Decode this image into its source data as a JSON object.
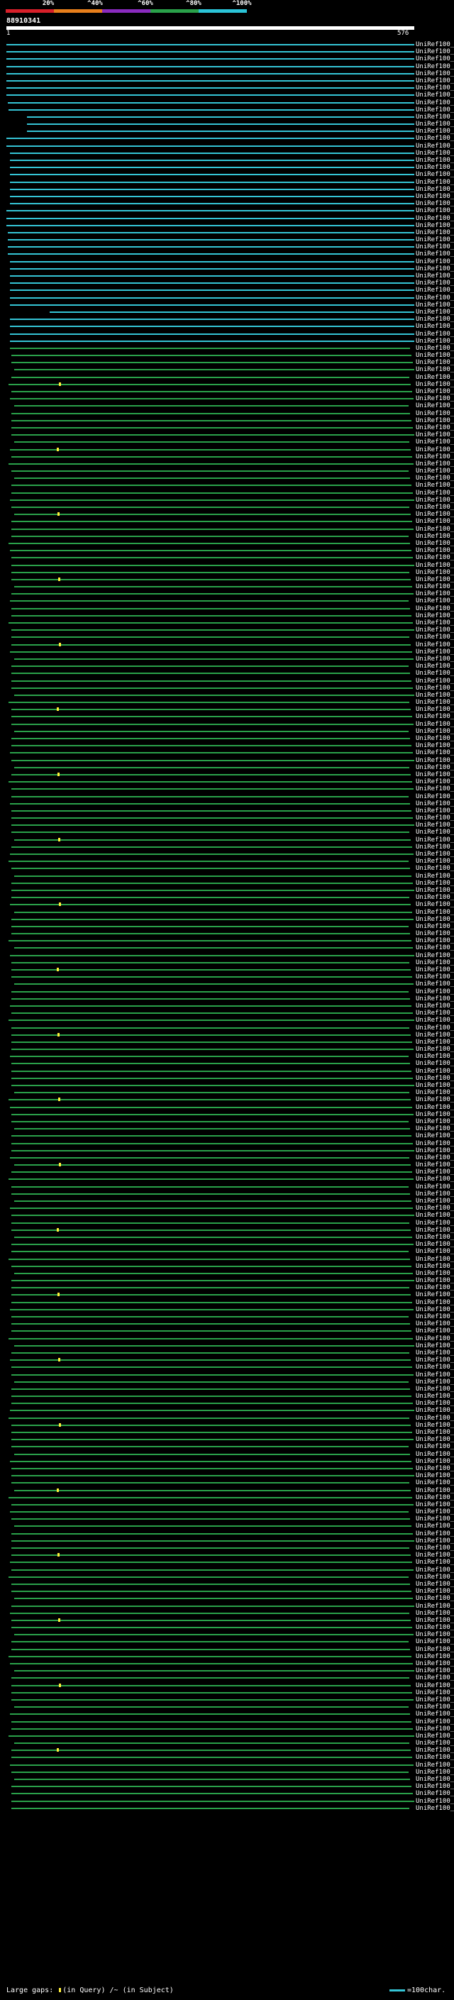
{
  "scale": {
    "labels": [
      "20%",
      "^40%",
      "^60%",
      "^80%",
      "^100%"
    ],
    "colors": [
      "#d8202a",
      "#e87f1c",
      "#8a2bbf",
      "#2aa14a",
      "#2bc3d7"
    ]
  },
  "query": {
    "id": "88910341",
    "start": "1",
    "end": "576"
  },
  "colors": {
    "high": "#35c5d6",
    "medium": "#2aa14a",
    "gap": "#ffef3a"
  },
  "hits": [
    "UniRef100_B9T183",
    "UniRef100_UP1000...",
    "UniRef100_A7Q355",
    "UniRef100_C5XZZ3",
    "UniRef100_Q6ER90",
    "UniRef100_B9AJF3",
    "UniRef100_A5BHW8",
    "UniRef100_UP1000...",
    "UniRef100_A5BJP5",
    "UniRef100_A9RXJ2",
    "UniRef100_A7Q360",
    "UniRef100_A5BRX1",
    "UniRef100_A5BHW9",
    "UniRef100_Q01539",
    "UniRef100_C1E045",
    "UniRef100_A4RZL4",
    "UniRef100_B4S221",
    "UniRef100_A3IS00",
    "UniRef100_Q4CAJ8",
    "UniRef100_Q3MZ48",
    "UniRef100_Q8YN47",
    "UniRef100_B5VWE3",
    "UniRef100_B5V5F7",
    "UniRef100_B1XK20",
    "UniRef100_C1MRF6",
    "UniRef100_A6YFP4",
    "UniRef100_B0JLF7",
    "UniRef100_B8BY34",
    "UniRef100_B0C012",
    "UniRef100_A5GJT7",
    "UniRef100_A4CX57",
    "UniRef100_Q3AW30",
    "UniRef100_Q2DC43",
    "UniRef100_D0C155",
    "UniRef100_B1X5P5",
    "UniRef100_Q7U662",
    "UniRef100_Q01902",
    "UniRef100_Q5QSW1",
    "UniRef100_A3IZ47",
    "UniRef100_B5G6Y8",
    "UniRef100_A9GS19",
    "UniRef100_Q05R70",
    "UniRef100_Q3AYC6",
    "UniRef100_B5IL96",
    "UniRef100_B7J7T0",
    "UniRef100_A0L4J6",
    "UniRef100_Q3UC80",
    "UniRef100_B0VRJ1",
    "UniRef100_B0VRJ2",
    "UniRef100_B2S162",
    "UniRef100_B5YLD2",
    "UniRef100_Q3ZB95",
    "UniRef100_A5FRB3",
    "UniRef100_A1RXE4",
    "UniRef100_C4CRK8",
    "UniRef100_B7QR90",
    "UniRef100_A6ICN7",
    "UniRef100_UP1000...",
    "UniRef100_UP1000...",
    "UniRef100_C0SWP8",
    "UniRef100_C0WKB2",
    "UniRef100_B9C3E7",
    "UniRef100_B9WBN6",
    "UniRef100_Q2SRD5",
    "UniRef100_B7J3S0",
    "UniRef100_C9WW13",
    "UniRef100_Q10401",
    "UniRef100_Q0SMD6",
    "UniRef100_Q1NJM1",
    "UniRef100_B2V6M2",
    "UniRef100_B1KS82",
    "UniRef100_C5VVB1",
    "UniRef100_A6ZLD5",
    "UniRef100_B5Y850",
    "UniRef100_B9Y829",
    "UniRef100_B7G348",
    "UniRef100_B7GV55",
    "UniRef100_B5M588",
    "UniRef100_Q66GF4",
    "UniRef100_C0ZGT7",
    "UniRef100_C0QRZ8",
    "UniRef100_B7K867",
    "UniRef100_C6N5K6",
    "UniRef100_A3IN06",
    "UniRef100_B5MRR3",
    "UniRef100_Q5NLX6",
    "UniRef100_C1DWX0",
    "UniRef100_B1Z8F0",
    "UniRef100_B1WPY0",
    "UniRef100_C4F1I6",
    "UniRef100_B0ULE1",
    "UniRef100_A6VMV8",
    "UniRef100_B5RQ59",
    "UniRef100_Q2JS31",
    "UniRef100_Q7NCU0",
    "UniRef100_B9ZPC7",
    "UniRef100_B4WR20",
    "UniRef100_Q8DGW0",
    "UniRef100_Q2JLF3",
    "UniRef100_B8HSY2",
    "UniRef100_B1XQ05",
    "UniRef100_B2KB24",
    "UniRef100_Q0I4G4",
    "UniRef100_Q8YWW0",
    "UniRef100_Q8YZX0",
    "UniRef100_Q55806",
    "UniRef100_B2J4B0",
    "UniRef100_A0YKJ6",
    "UniRef100_B4VMD8",
    "UniRef100_Q11557",
    "UniRef100_Q8YX65",
    "UniRef100_C6XYI1",
    "UniRef100_C6AWB7",
    "UniRef100_Q1IHB5",
    "UniRef100_B4U7U2",
    "UniRef100_A0US89",
    "UniRef100_Q89TL0",
    "UniRef100_C1F3K5",
    "UniRef100_Q1LR23",
    "UniRef100_A6WAE5",
    "UniRef100_A5G4T7",
    "UniRef100_B1T4K7",
    "UniRef100_B9M524",
    "UniRef100_C4ILJ1",
    "UniRef100_C6PW03",
    "UniRef100_Q2W650",
    "UniRef100_B1N5Y8",
    "UniRef100_A1HTC8",
    "UniRef100_Q3H4P3",
    "UniRef100_B5EBX9",
    "UniRef100_UP1000...",
    "UniRef100_Q39V59",
    "UniRef100_A6R1B6",
    "UniRef100_C8W7Y0",
    "UniRef100_B1ULW1",
    "UniRef100_C7BPV0",
    "UniRef100_A0LFC2",
    "UniRef100_C7GZW4",
    "UniRef100_B0E228",
    "UniRef100_B0K3V8",
    "UniRef100_C0XUG2",
    "UniRef100_UP1000...",
    "UniRef100_Q67583",
    "UniRef100_C7IQZ8",
    "UniRef100_C6SPB0",
    "UniRef100_C6Q900",
    "UniRef100_C6PFY0",
    "UniRef100_B9K8B0",
    "UniRef100_C0GSX6",
    "UniRef100_A7G1V8",
    "UniRef100_A7FYY7",
    "UniRef100_B5YDY7",
    "UniRef100_C6DYJ5",
    "UniRef100_Q3AB56",
    "UniRef100_UP1000...",
    "UniRef100_C4V3B8",
    "UniRef100_B5HSP5",
    "UniRef100_C9L873",
    "UniRef100_B3E1T5",
    "UniRef100_B8J4E4",
    "UniRef100_B1LQT7",
    "UniRef100_B1I4H3",
    "UniRef100_Q2YZU9",
    "UniRef100_C4FPN0",
    "UniRef100_B1YK92",
    "UniRef100_Q8ET12",
    "UniRef100_Q3AMR6",
    "UniRef100_C1ZM36",
    "UniRef100_Q74D04",
    "UniRef100_B6WMN7",
    "UniRef100_B1IMV3",
    "UniRef100_C6HX24",
    "UniRef100_B5GNX0",
    "UniRef100_UP1000...",
    "UniRef100_UP1000...",
    "UniRef100_C9Z629",
    "UniRef100_C0VJ23",
    "UniRef100_Q9L278",
    "UniRef100_C9YRY7",
    "UniRef100_Q82PU8",
    "UniRef100_C5H4U2",
    "UniRef100_C0R6T4",
    "UniRef100_Q728R5",
    "UniRef100_A7N694",
    "UniRef100_A5D0U7",
    "UniRef100_A4IRN4",
    "UniRef100_B9WU08",
    "UniRef100_B6EPN2",
    "UniRef100_A5CXT4",
    "UniRef100_C7LY69",
    "UniRef100_C5LU22",
    "UniRef100_C0GJN1",
    "UniRef100_A6LE67",
    "UniRef100_C6GWZ1",
    "UniRef100_C9RSY3",
    "UniRef100_C1HRY4",
    "UniRef100_C3IUW8",
    "UniRef100_A9M2F0",
    "UniRef100_A9B2N7",
    "UniRef100_C6PRC7",
    "UniRef100_UP1000...",
    "UniRef100_B9F2M6",
    "UniRef100_UP1000...",
    "UniRef100_A5UF17",
    "UniRef100_C6MVW1",
    "UniRef100_C6QX07",
    "UniRef100_C0ZVV0",
    "UniRef100_C8WOF7",
    "UniRef100_B6W6K9",
    "UniRef100_C8WR15",
    "UniRef100_C1SSP0",
    "UniRef100_B7GP37",
    "UniRef100_B4V6A0",
    "UniRef100_C7LDC6",
    "UniRef100_C7INS9",
    "UniRef100_B1LSF5",
    "UniRef100_Q5HXT3",
    "UniRef100_Q9S5K4",
    "UniRef100_B7GGN9",
    "UniRef100_C4AFD7",
    "UniRef100_C5V5M6",
    "UniRef100_C5D639",
    "UniRef100_Q04HR1",
    "UniRef100_C3B7K6",
    "UniRef100_C2MBJ7",
    "UniRef100_C2C1N7",
    "UniRef100_C4L4B1",
    "UniRef100_A8ZXY4",
    "UniRef100_UP1000...",
    "UniRef100_C9NH07",
    "UniRef100_C0EE66",
    "UniRef100_B1K3F0",
    "UniRef100_A4F2N1",
    "UniRef100_UP1000...",
    "UniRef100_B0KE33",
    "UniRef100_C3DYR1",
    "UniRef100_Q3D9U5",
    "UniRef100_C5WVU8",
    "UniRef100_C9W707",
    "UniRef100_B1EE03",
    "UniRef100_A3CP58",
    "UniRef100_A6WAB7",
    "UniRef100_Q8K693",
    "UniRef100_C0A124",
    "UniRef100_B7E3S0"
  ],
  "footer": {
    "gaps_label": "Large gaps:",
    "in_query": "(in Query)",
    "in_subject": "/~ (in Subject)",
    "legend_text": "=100char."
  }
}
